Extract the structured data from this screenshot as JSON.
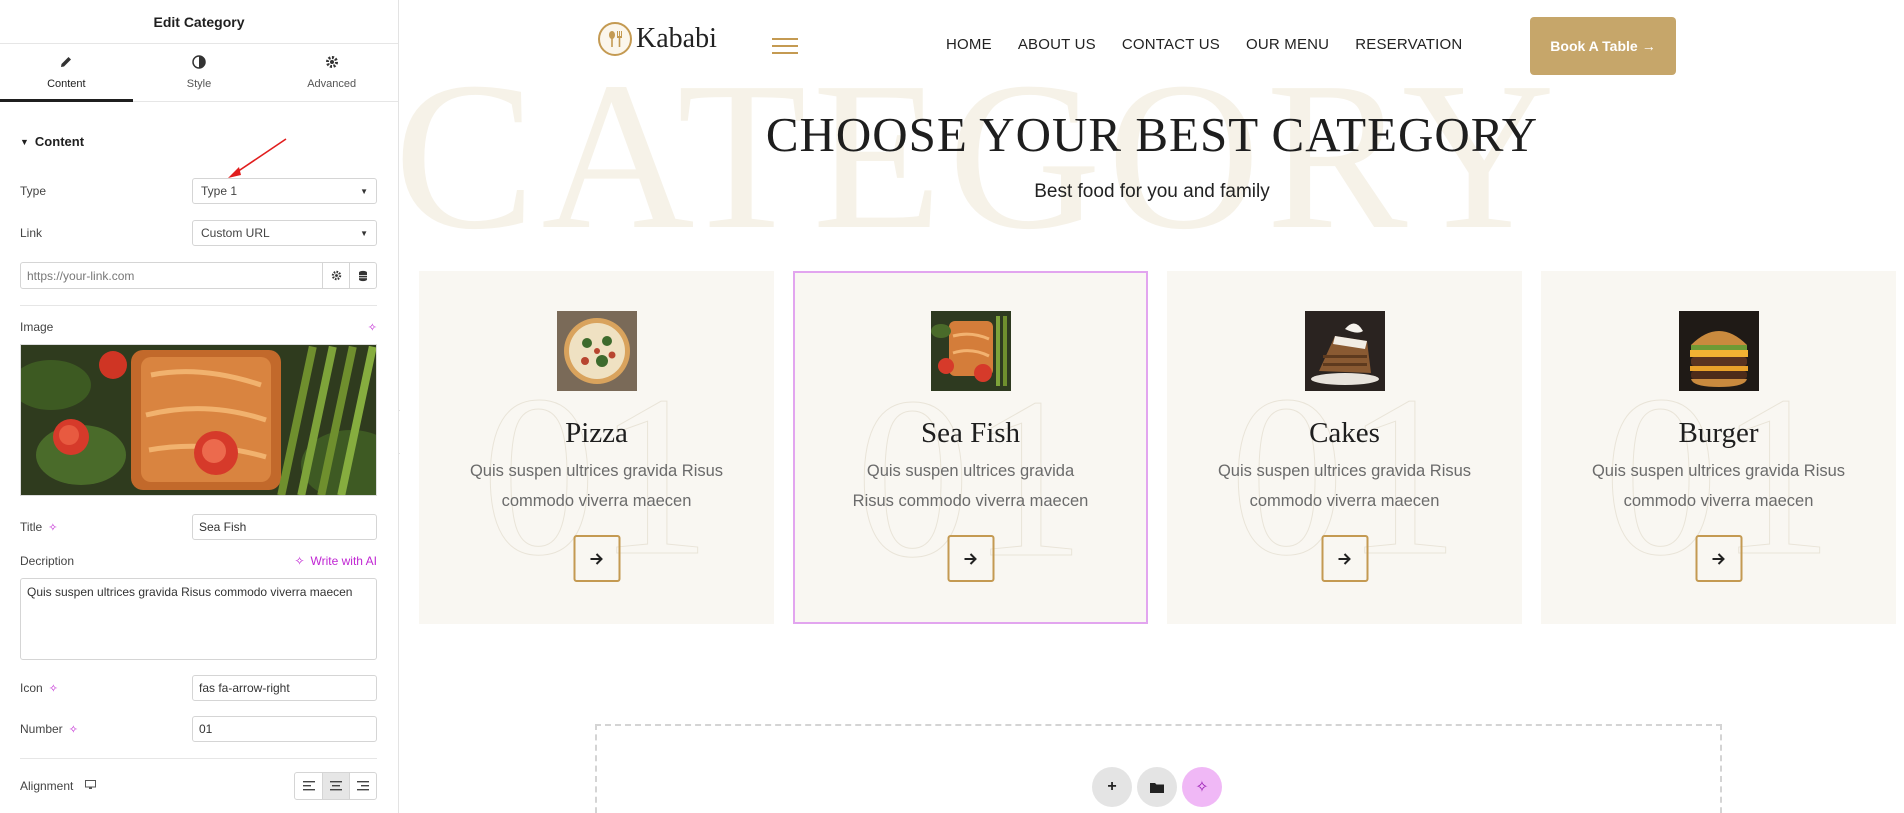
{
  "panel": {
    "title": "Edit Category",
    "tabs": [
      {
        "label": "Content",
        "icon": "pencil-icon"
      },
      {
        "label": "Style",
        "icon": "contrast-icon"
      },
      {
        "label": "Advanced",
        "icon": "gear-icon"
      }
    ],
    "section_title": "Content",
    "fields": {
      "type_label": "Type",
      "type_value": "Type 1",
      "link_label": "Link",
      "link_value": "Custom URL",
      "url_placeholder": "https://your-link.com",
      "image_label": "Image",
      "title_label": "Title",
      "title_value": "Sea Fish",
      "description_label": "Decription",
      "write_ai_label": "Write with AI",
      "description_value": "Quis suspen ultrices gravida Risus commodo viverra maecen",
      "icon_label": "Icon",
      "icon_value": "fas fa-arrow-right",
      "number_label": "Number",
      "number_value": "01",
      "alignment_label": "Alignment"
    }
  },
  "site": {
    "logo_text": "Kababi",
    "nav": [
      "HOME",
      "ABOUT US",
      "CONTACT US",
      "OUR MENU",
      "RESERVATION"
    ],
    "book_button": "Book A Table",
    "bg_word": "CATEGORY",
    "heading": "CHOOSE YOUR BEST CATEGORY",
    "subheading": "Best food for you and family",
    "cards": [
      {
        "title": "Pizza",
        "desc": "Quis suspen ultrices gravida Risus commodo viverra maecen",
        "number": "01"
      },
      {
        "title": "Sea Fish",
        "desc": "Quis suspen ultrices gravida Risus commodo viverra maecen",
        "number": "01"
      },
      {
        "title": "Cakes",
        "desc": "Quis suspen ultrices gravida Risus commodo viverra maecen",
        "number": "01"
      },
      {
        "title": "Burger",
        "desc": "Quis suspen ultrices gravida Risus commodo viverra maecen",
        "number": "01"
      }
    ]
  },
  "colors": {
    "accent_gold": "#c49a52",
    "button_bg": "#c6a66a",
    "card_bg": "#f9f7f2",
    "selection_outline": "#e2a5ef",
    "ai_magenta": "#c026d3"
  }
}
